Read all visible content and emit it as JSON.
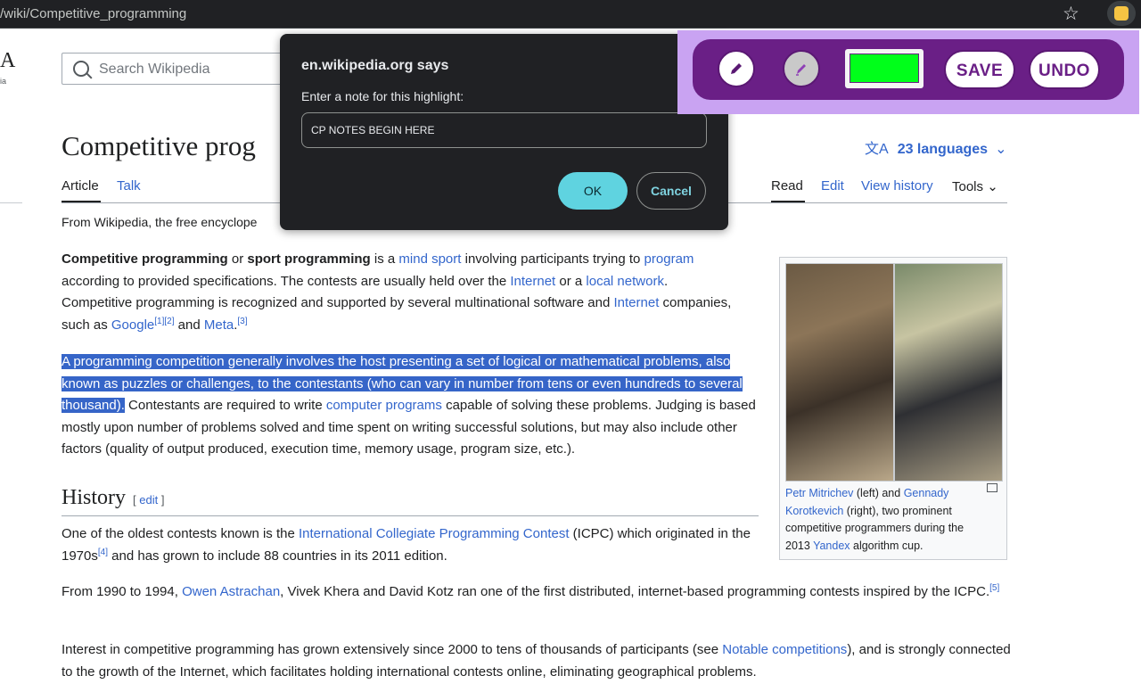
{
  "browser": {
    "url": "/wiki/Competitive_programming"
  },
  "wiki": {
    "logo": "A",
    "logo_sub": "ia",
    "search_placeholder": "Search Wikipedia",
    "title": "Competitive prog",
    "languages": "23 languages",
    "tabs": {
      "article": "Article",
      "talk": "Talk",
      "read": "Read",
      "edit": "Edit",
      "history": "View history",
      "tools": "Tools"
    },
    "tagline": "From Wikipedia, the free encyclope",
    "p1": {
      "b1": "Competitive programming",
      "t1": " or ",
      "b2": "sport programming",
      "t2": " is a ",
      "l1": "mind sport",
      "t3": " involving participants trying to ",
      "l2": "program",
      "t4": " according to provided specifications. The contests are usually held over the ",
      "l3": "Internet",
      "t5": " or a ",
      "l4": "local network",
      "t6": ". Competitive programming is recognized and supported by several multinational software and ",
      "l5": "Internet",
      "t7": " companies, such as ",
      "l6": "Google",
      "s1": "[1]",
      "s2": "[2]",
      "t8": " and ",
      "l7": "Meta",
      "t9": ".",
      "s3": "[3]"
    },
    "p2": {
      "hl": "A programming competition generally involves the host presenting a set of logical or mathematical problems, also known as puzzles or challenges, to the contestants (who can vary in number from tens or even hundreds to several thousand).",
      "t1": " Contestants are required to write ",
      "l1": "computer programs",
      "t2": " capable of solving these problems. Judging is based mostly upon number of problems solved and time spent on writing successful solutions, but may also include other factors (quality of output produced, execution time, memory usage, program size, etc.)."
    },
    "history": {
      "heading": "History",
      "edit_open": "[ ",
      "edit": "edit",
      "edit_close": " ]"
    },
    "p3": {
      "t1": "One of the oldest contests known is the ",
      "l1": "International Collegiate Programming Contest",
      "t2": " (ICPC) which originated in the 1970s",
      "s1": "[4]",
      "t3": " and has grown to include 88 countries in its 2011 edition."
    },
    "p4": {
      "t1": "From 1990 to 1994, ",
      "l1": "Owen Astrachan",
      "t2": ", Vivek Khera and David Kotz ran one of the first distributed, internet-based programming contests inspired by the ICPC.",
      "s1": "[5]"
    },
    "p5": {
      "t1": "Interest in competitive programming has grown extensively since 2000 to tens of thousands of participants (see ",
      "l1": "Notable competitions",
      "t2": "), and is strongly connected to the growth of the Internet, which facilitates holding international contests online, eliminating geographical problems."
    },
    "infobox": {
      "l1": "Petr Mitrichev",
      "t1": " (left) and ",
      "l2": "Gennady Korotkevich",
      "t2": " (right), two prominent competitive programmers during the 2013 ",
      "l3": "Yandex",
      "t3": " algorithm cup."
    }
  },
  "dialog": {
    "title": "en.wikipedia.org says",
    "message": "Enter a note for this highlight:",
    "input_value": "CP NOTES BEGIN HERE",
    "ok": "OK",
    "cancel": "Cancel"
  },
  "extension": {
    "save": "SAVE",
    "undo": "UNDO",
    "color": "#00ff1a"
  }
}
